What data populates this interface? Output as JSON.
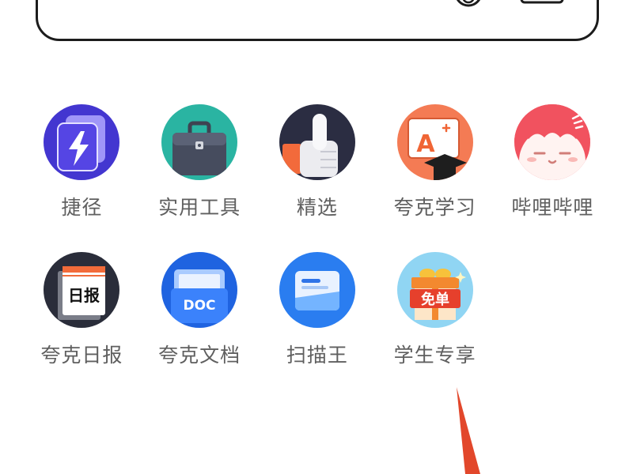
{
  "search_bar": {
    "icons": [
      "microphone-icon",
      "scan-icon"
    ]
  },
  "apps": [
    {
      "label": "捷径",
      "icon": "shortcut-icon",
      "bg": "#4336d0"
    },
    {
      "label": "实用工具",
      "icon": "toolbox-icon",
      "bg": "#2ab4a2"
    },
    {
      "label": "精选",
      "icon": "thumbs-up-icon",
      "bg": "#2b2d42"
    },
    {
      "label": "夸克学习",
      "icon": "study-icon",
      "bg": "#f47b54",
      "icon_text": "A"
    },
    {
      "label": "哔哩哔哩",
      "icon": "bilibili-icon",
      "bg": "#f1525f"
    },
    {
      "label": "夸克日报",
      "icon": "daily-news-icon",
      "bg": "#2a2d3a",
      "icon_text": "日报"
    },
    {
      "label": "夸克文档",
      "icon": "document-folder-icon",
      "bg": "#1f63e0",
      "icon_text": "DOC"
    },
    {
      "label": "扫描王",
      "icon": "scanner-icon",
      "bg": "#2a7df0"
    },
    {
      "label": "学生专享",
      "icon": "gift-box-icon",
      "bg": "#90d5f3",
      "icon_text": "免单"
    }
  ],
  "annotation": {
    "arrow_icon": "arrow-up-icon",
    "arrow_color": "#e2472b"
  }
}
